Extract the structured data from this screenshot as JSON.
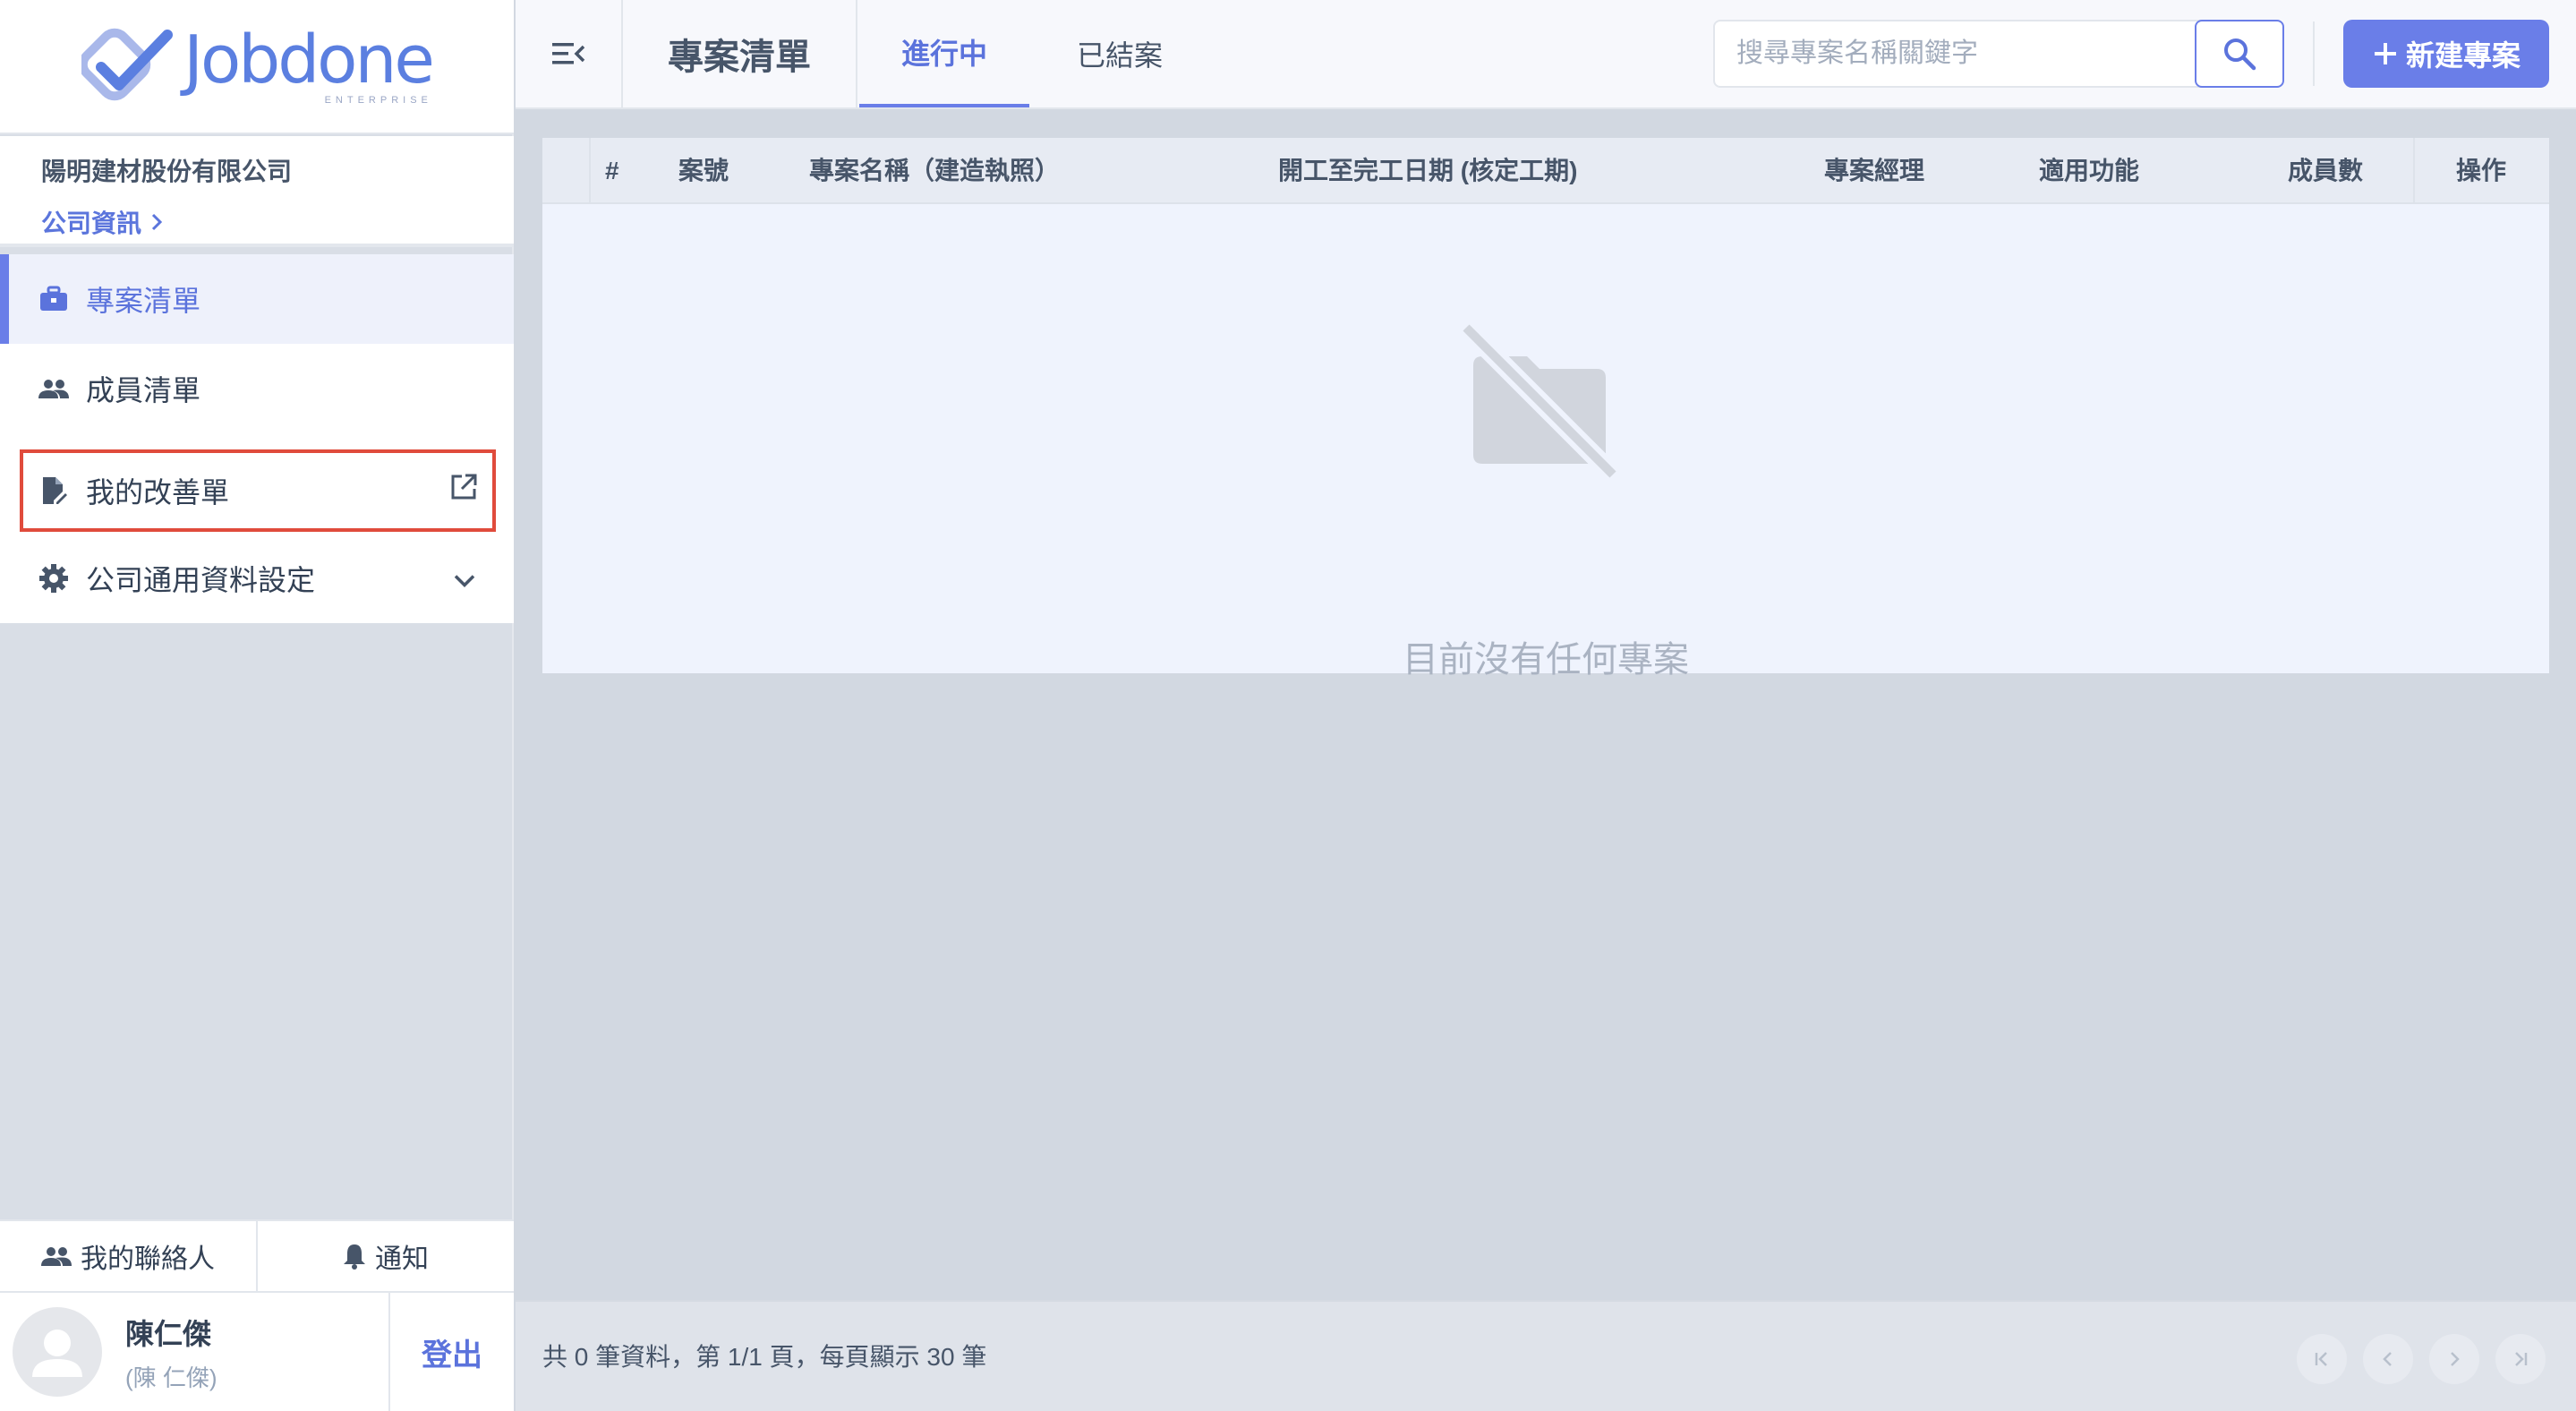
{
  "app": {
    "logo_text": "Jobdone",
    "logo_subtext": "ENTERPRISE",
    "accent_color": "#6a7ee8",
    "highlight_color": "#e04b3c"
  },
  "company": {
    "name": "陽明建材股份有限公司",
    "info_link": "公司資訊"
  },
  "sidebar": {
    "items": [
      {
        "label": "專案清單",
        "icon": "briefcase-icon",
        "active": true
      },
      {
        "label": "成員清單",
        "icon": "people-icon"
      },
      {
        "label": "我的改善單",
        "icon": "document-edit-icon",
        "trailing_icon": "external-link-icon",
        "highlighted": true
      },
      {
        "label": "公司通用資料設定",
        "icon": "gear-icon",
        "trailing_icon": "chevron-down-icon"
      }
    ],
    "bottom_tabs": [
      {
        "label": "我的聯絡人",
        "icon": "people-icon"
      },
      {
        "label": "通知",
        "icon": "bell-icon"
      }
    ],
    "user": {
      "name": "陳仁傑",
      "subname": "(陳 仁傑)",
      "logout_label": "登出"
    }
  },
  "header": {
    "title": "專案清單",
    "tabs": [
      {
        "label": "進行中",
        "active": true
      },
      {
        "label": "已結案"
      }
    ],
    "search": {
      "placeholder": "搜尋專案名稱關鍵字",
      "value": ""
    },
    "new_button_label": "新建專案"
  },
  "table": {
    "columns": [
      "#",
      "案號",
      "專案名稱（建造執照）",
      "開工至完工日期 (核定工期)",
      "專案經理",
      "適用功能",
      "成員數",
      "操作"
    ],
    "rows": [],
    "empty_message": "目前沒有任何專案"
  },
  "footer": {
    "summary": "共 0 筆資料，第 1/1 頁，每頁顯示 30 筆"
  }
}
